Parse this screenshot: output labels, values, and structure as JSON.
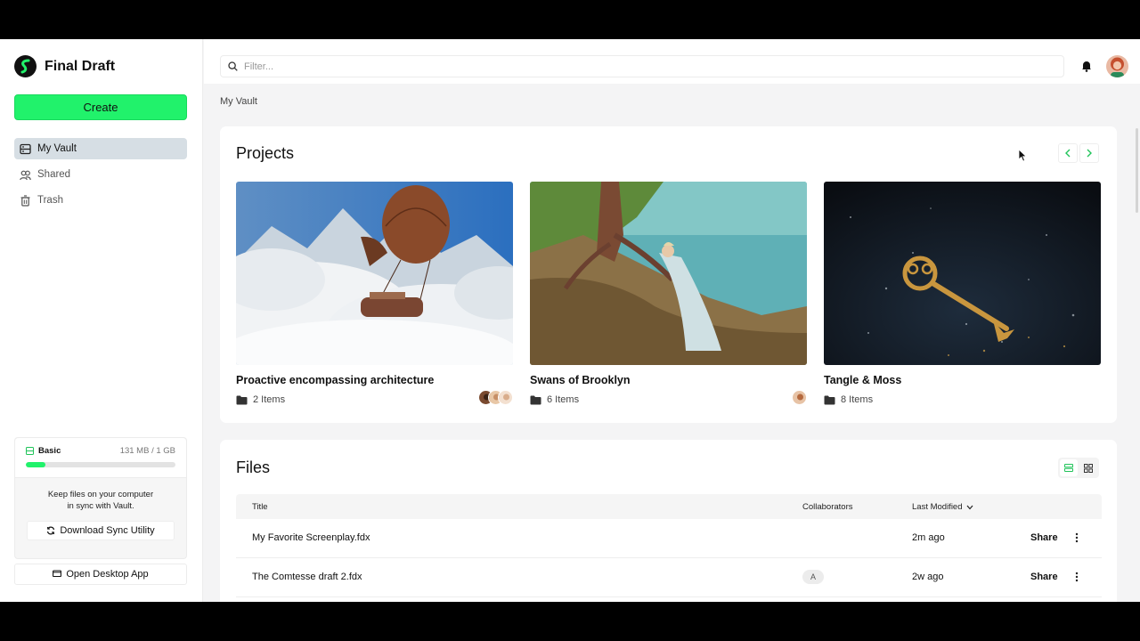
{
  "app": {
    "name": "Final Draft"
  },
  "sidebar": {
    "create_label": "Create",
    "items": [
      {
        "label": "My Vault",
        "icon": "vault-icon",
        "active": true
      },
      {
        "label": "Shared",
        "icon": "users-icon",
        "active": false
      },
      {
        "label": "Trash",
        "icon": "trash-icon",
        "active": false
      }
    ],
    "storage": {
      "plan": "Basic",
      "usage": "131 MB / 1 GB",
      "used_fraction": 0.13,
      "sync_text_line1": "Keep files on your computer",
      "sync_text_line2": "in sync with Vault.",
      "sync_button": "Download Sync Utility"
    },
    "desktop_button": "Open Desktop App"
  },
  "topbar": {
    "filter_placeholder": "Filter...",
    "bell_icon": "bell-icon"
  },
  "breadcrumb": "My Vault",
  "projects": {
    "title": "Projects",
    "cards": [
      {
        "title": "Proactive encompassing architecture",
        "items": "2 Items",
        "image": "hot-air-balloon-over-clouds"
      },
      {
        "title": "Swans of Brooklyn",
        "items": "6 Items",
        "image": "woman-by-tree-at-lake"
      },
      {
        "title": "Tangle & Moss",
        "items": "8 Items",
        "image": "golden-key-on-dark-sparkles"
      }
    ]
  },
  "files": {
    "title": "Files",
    "columns": {
      "title": "Title",
      "collaborators": "Collaborators",
      "modified": "Last Modified"
    },
    "rows": [
      {
        "title": "My Favorite Screenplay.fdx",
        "collaborator": "",
        "modified": "2m ago",
        "action": "Share"
      },
      {
        "title": "The Comtesse draft 2.fdx",
        "collaborator": "A",
        "modified": "2w ago",
        "action": "Share"
      }
    ]
  },
  "colors": {
    "accent": "#21f26b",
    "active_nav": "#d6dee4",
    "background": "#f4f4f5"
  }
}
